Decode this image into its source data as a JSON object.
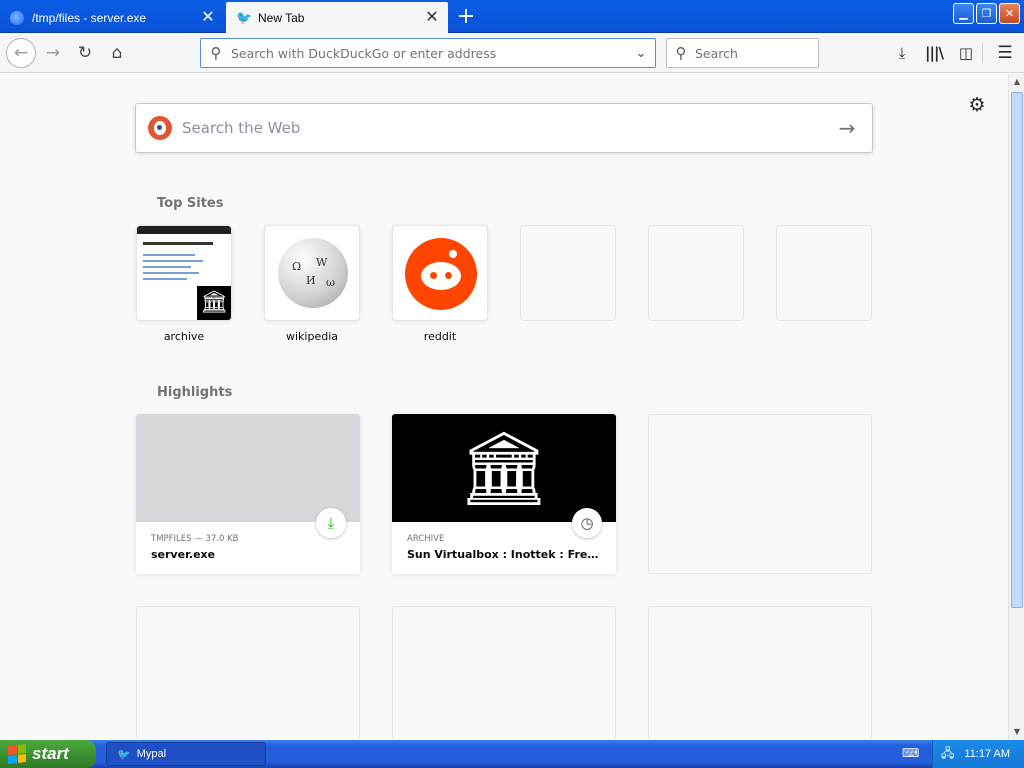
{
  "tabs": [
    {
      "title": "/tmp/files - server.exe",
      "active": false
    },
    {
      "title": "New Tab",
      "active": true
    }
  ],
  "tab_close_glyph": "✕",
  "new_tab_glyph": "+",
  "window_controls": {
    "minimize": "▁",
    "maximize": "❐",
    "close": "✕"
  },
  "navbar": {
    "url_placeholder": "Search with DuckDuckGo or enter address",
    "search_placeholder": "Search"
  },
  "websearch": {
    "placeholder": "Search the Web"
  },
  "top_sites": {
    "title": "Top Sites",
    "items": [
      {
        "label": "archive"
      },
      {
        "label": "wikipedia"
      },
      {
        "label": "reddit"
      },
      {
        "label": ""
      },
      {
        "label": ""
      },
      {
        "label": ""
      }
    ]
  },
  "highlights": {
    "title": "Highlights",
    "items": [
      {
        "meta": "TMPFILES — 37.0 KB",
        "name": "server.exe",
        "badge": "download-icon"
      },
      {
        "meta": "ARCHIVE",
        "name": "Sun Virtualbox : Inottek : Free Download, Borrow, and Streaming : Internet Archive",
        "badge": "clock-icon"
      }
    ]
  },
  "taskbar": {
    "start_label": "start",
    "task_label": "Mypal",
    "clock": "11:17 AM"
  },
  "colors": {
    "accent": "#0a84ff",
    "titlebar": "#0b5ee6",
    "taskbar": "#245edb",
    "start_green": "#3c9131",
    "reddit_orange": "#ff4500",
    "ddg_orange": "#de5833",
    "download_green": "#12bc00"
  }
}
